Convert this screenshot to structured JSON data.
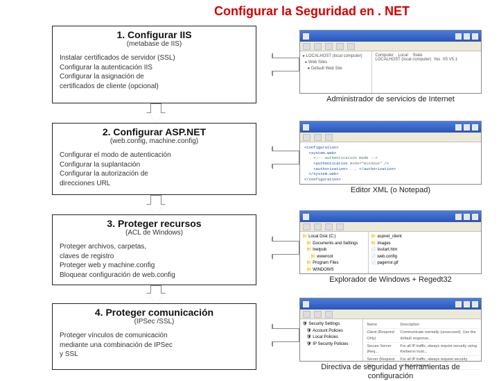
{
  "title": "Configurar la Seguridad en . NET",
  "steps": [
    {
      "header": "1. Configurar IIS",
      "sub": "(metabase de IIS)",
      "lines": [
        "Instalar certificados de servidor (SSL)",
        "Configurar la autenticación IIS",
        "Configurar la asignación de",
        "certificados de cliente (opcional)"
      ]
    },
    {
      "header": "2. Configurar ASP.NET",
      "sub": "(web.config, machine.config)",
      "lines": [
        "Configurar el modo de autenticación",
        "Configurar la suplantación",
        "Configurar la autorización de",
        "direcciones URL"
      ]
    },
    {
      "header": "3. Proteger recursos",
      "sub": "(ACL de Windows)",
      "lines": [
        "Proteger archivos, carpetas,",
        "claves de registro",
        "Proteger web y machine.config",
        "Bloquear configuración de web.config"
      ]
    },
    {
      "header": "4. Proteger comunicación",
      "sub": "(IPSec /SSL)",
      "lines": [
        "Proteger vínculos de comunicación",
        "mediante una combinación de IPSec",
        "y SSL"
      ]
    }
  ],
  "captions": [
    "Administrador de servicios de Internet",
    "Editor XML (o Notepad)",
    "Explorador de Windows + Regedt32",
    "Directiva de seguridad y herramientas de configuración"
  ]
}
